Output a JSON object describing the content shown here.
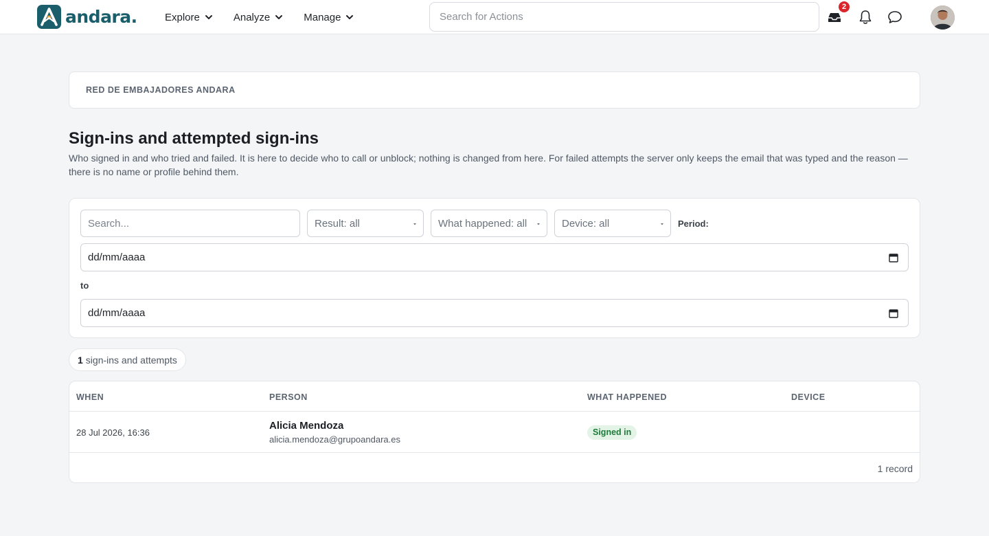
{
  "header": {
    "logo_text": "andara.",
    "nav": [
      {
        "label": "Explore"
      },
      {
        "label": "Analyze"
      },
      {
        "label": "Manage"
      }
    ],
    "search_placeholder": "Search for Actions",
    "inbox_badge": "2",
    "icons": [
      "inbox-icon",
      "bell-icon",
      "chat-icon"
    ]
  },
  "org": {
    "name": "RED DE EMBAJADORES ANDARA"
  },
  "page": {
    "title": "Sign-ins and attempted sign-ins",
    "description": "Who signed in and who tried and failed. It is here to decide who to call or unblock; nothing is changed from here. For failed attempts the server only keeps the email that was typed and the reason — there is no name or profile behind them."
  },
  "filters": {
    "search_placeholder": "Search...",
    "result": "Result: all",
    "what_happened": "What happened: all",
    "device": "Device: all",
    "period_label": "Period:",
    "date_from": "dd/mm/aaaa",
    "to_label": "to",
    "date_to": "dd/mm/aaaa"
  },
  "count": {
    "number": "1",
    "label": "sign-ins and attempts"
  },
  "table": {
    "columns": [
      "WHEN",
      "PERSON",
      "WHAT HAPPENED",
      "DEVICE"
    ],
    "rows": [
      {
        "when": "28 Jul 2026, 16:36",
        "name": "Alicia Mendoza",
        "email": "alicia.mendoza@grupoandara.es",
        "status": "Signed in",
        "device": ""
      }
    ],
    "footer": "1 record"
  },
  "colors": {
    "brand": "#1b5e6b",
    "badge": "#d9252b",
    "success_bg": "#e3f4e7",
    "success_text": "#1e7a3a"
  }
}
